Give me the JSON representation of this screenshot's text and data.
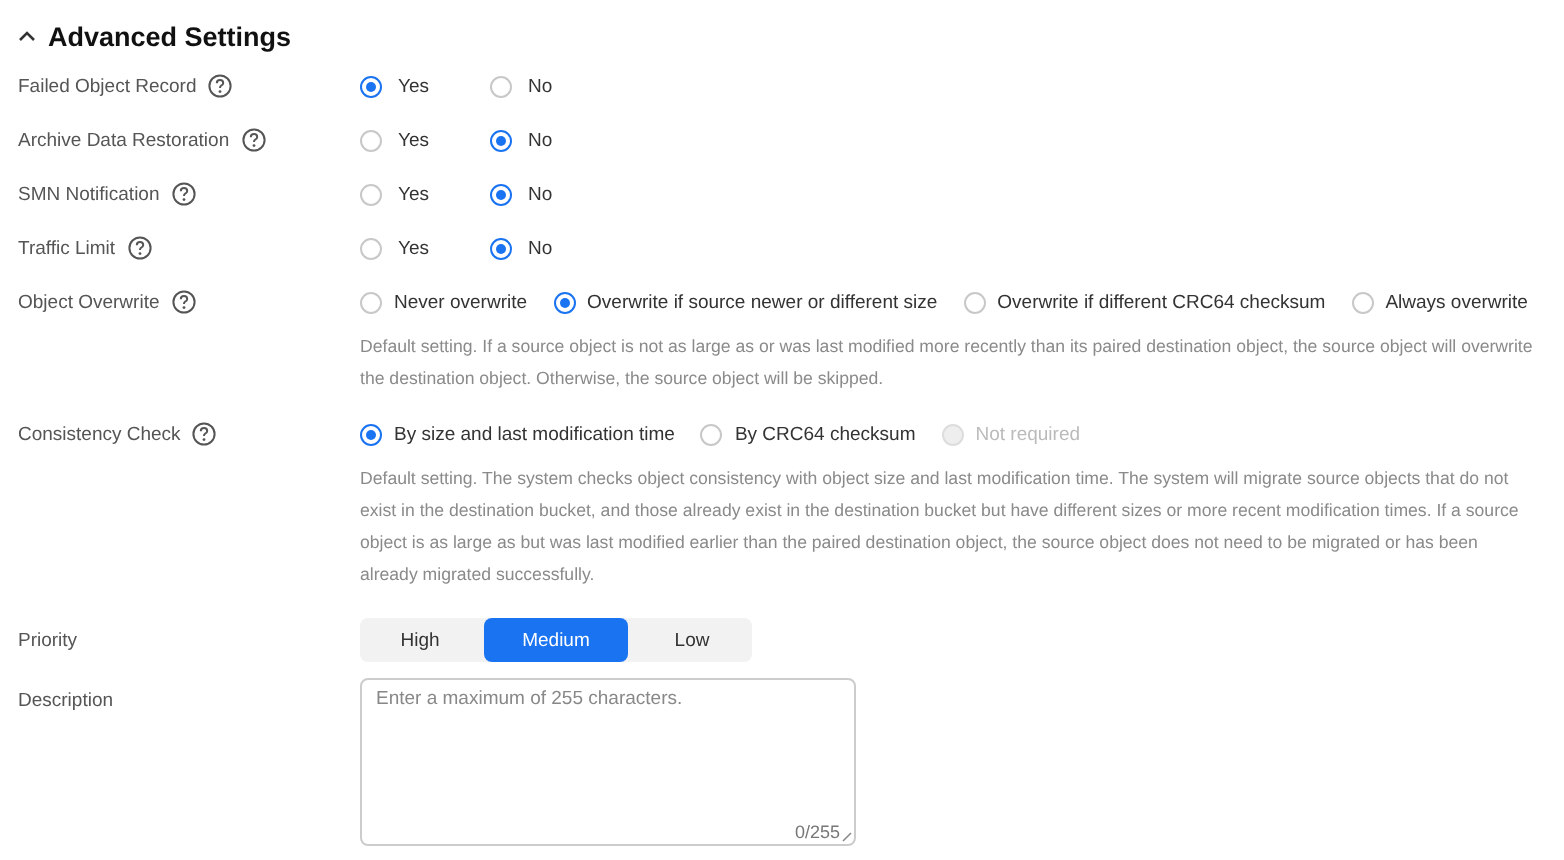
{
  "section": {
    "title": "Advanced Settings",
    "expanded": true
  },
  "fields": [
    {
      "kind": "radio",
      "label": "Failed Object Record",
      "help": true,
      "options": [
        {
          "label": "Yes",
          "selected": true
        },
        {
          "label": "No",
          "selected": false
        }
      ]
    },
    {
      "kind": "radio",
      "label": "Archive Data Restoration",
      "help": true,
      "options": [
        {
          "label": "Yes",
          "selected": false
        },
        {
          "label": "No",
          "selected": true
        }
      ]
    },
    {
      "kind": "radio",
      "label": "SMN Notification",
      "help": true,
      "options": [
        {
          "label": "Yes",
          "selected": false
        },
        {
          "label": "No",
          "selected": true
        }
      ]
    },
    {
      "kind": "radio",
      "label": "Traffic Limit",
      "help": true,
      "options": [
        {
          "label": "Yes",
          "selected": false
        },
        {
          "label": "No",
          "selected": true
        }
      ]
    },
    {
      "kind": "radio",
      "label": "Object Overwrite",
      "help": true,
      "options": [
        {
          "label": "Never overwrite",
          "selected": false
        },
        {
          "label": "Overwrite if source newer or different size",
          "selected": true
        },
        {
          "label": "Overwrite if different CRC64 checksum",
          "selected": false
        },
        {
          "label": "Always overwrite",
          "selected": false
        }
      ],
      "note": "Default setting. If a source object is not as large as or was last modified more recently than its paired destination object, the source object will overwrite the destination object. Otherwise, the source object will be skipped."
    },
    {
      "kind": "radio",
      "label": "Consistency Check",
      "help": true,
      "options": [
        {
          "label": "By size and last modification time",
          "selected": true,
          "disabled": false
        },
        {
          "label": "By CRC64 checksum",
          "selected": false,
          "disabled": false
        },
        {
          "label": "Not required",
          "selected": false,
          "disabled": true
        }
      ],
      "note": "Default setting. The system checks object consistency with object size and last modification time. The system will migrate source objects that do not exist in the destination bucket, and those already exist in the destination bucket but have different sizes or more recent modification times. If a source object is as large as but was last modified earlier than the paired destination object, the source object does not need to be migrated or has been already migrated successfully."
    },
    {
      "kind": "segmented",
      "label": "Priority",
      "help": false,
      "options": [
        {
          "label": "High",
          "selected": false
        },
        {
          "label": "Medium",
          "selected": true
        },
        {
          "label": "Low",
          "selected": false
        }
      ]
    },
    {
      "kind": "textarea",
      "label": "Description",
      "help": false,
      "placeholder": "Enter a maximum of 255 characters.",
      "counter": "0/255"
    }
  ]
}
